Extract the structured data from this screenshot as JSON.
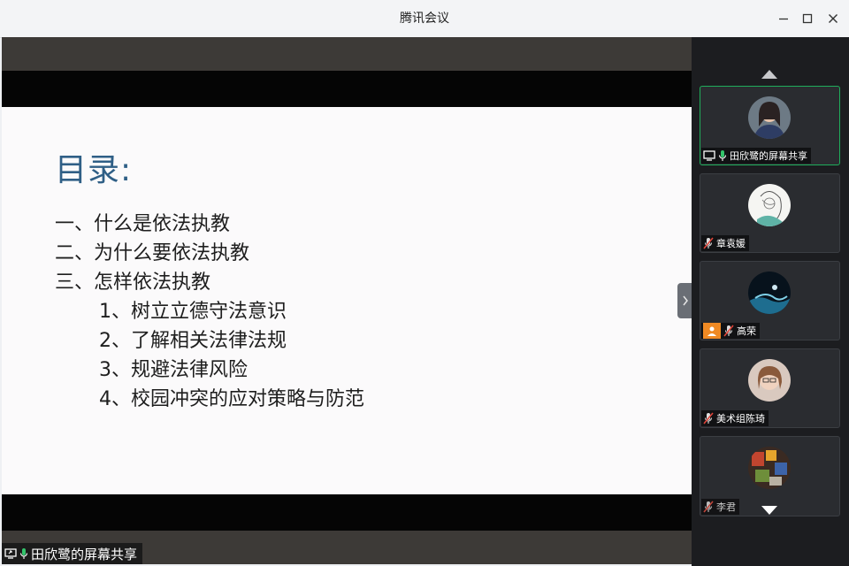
{
  "window": {
    "title": "腾讯会议"
  },
  "slide": {
    "title": "目录:",
    "items": [
      "一、什么是依法执教",
      "二、为什么要依法执教",
      "三、怎样依法执教"
    ],
    "subitems": [
      "1、树立立德守法意识",
      "2、了解相关法律法规",
      "3、规避法律风险",
      "4、校园冲突的应对策略与防范"
    ]
  },
  "share_label": "田欣鹭的屏幕共享",
  "participants": [
    {
      "name": "田欣鹭的屏幕共享"
    },
    {
      "name": "章袁媛"
    },
    {
      "name": "高荣"
    },
    {
      "name": "美术组陈琦"
    },
    {
      "name": "李君"
    }
  ],
  "colors": {
    "accent_green": "#1fae5b",
    "slide_title": "#2f5f86",
    "muted_red": "#e0453a",
    "video_orange": "#f08a24"
  }
}
